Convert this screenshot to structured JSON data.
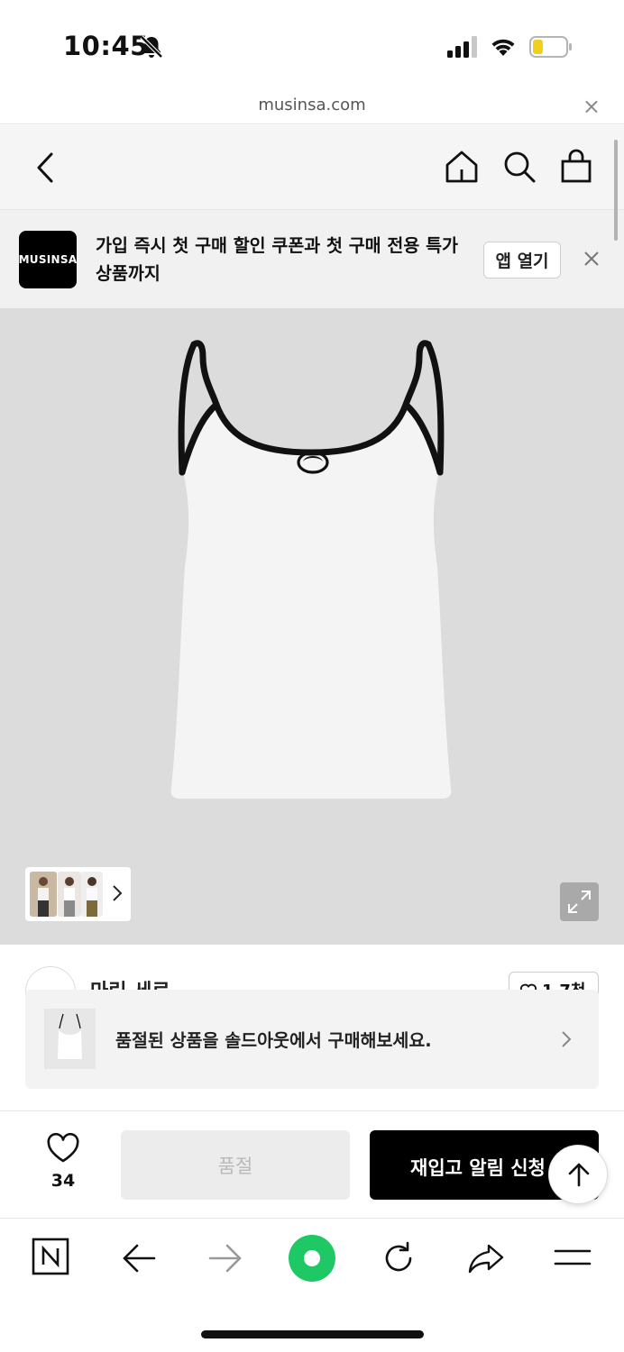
{
  "status_bar": {
    "time": "10:45"
  },
  "url_bar": {
    "url": "musinsa.com",
    "close_glyph": "×"
  },
  "app_banner": {
    "logo_text": "MUSINSA",
    "text": "가입 즉시 첫 구매 할인 쿠폰과 첫 구매 전용 특가 상품까지",
    "open_button_label": "앱 열기"
  },
  "brand": {
    "name": "마린 세르",
    "likes": "1.7천"
  },
  "soldout_notice": {
    "text": "품절된 상품을 솔드아웃에서 구매해보세요."
  },
  "purchase_bar": {
    "wish_count": "34",
    "soldout_label": "품절",
    "restock_label": "재입고 알림 신청"
  },
  "colors": {
    "accent_green": "#1ec800",
    "black": "#000000",
    "soldout_button_bg": "#ececec",
    "image_bg": "#dcdcdc"
  },
  "icons": [
    "bell-slash-icon",
    "signal-icon",
    "wifi-icon",
    "battery-icon",
    "back-icon",
    "home-icon",
    "search-icon",
    "bag-icon",
    "close-icon",
    "expand-icon",
    "heart-icon",
    "arrow-up-icon",
    "naver-icon",
    "browser-back-icon",
    "browser-forward-icon",
    "green-dot-icon",
    "reload-icon",
    "share-icon",
    "menu-icon"
  ]
}
